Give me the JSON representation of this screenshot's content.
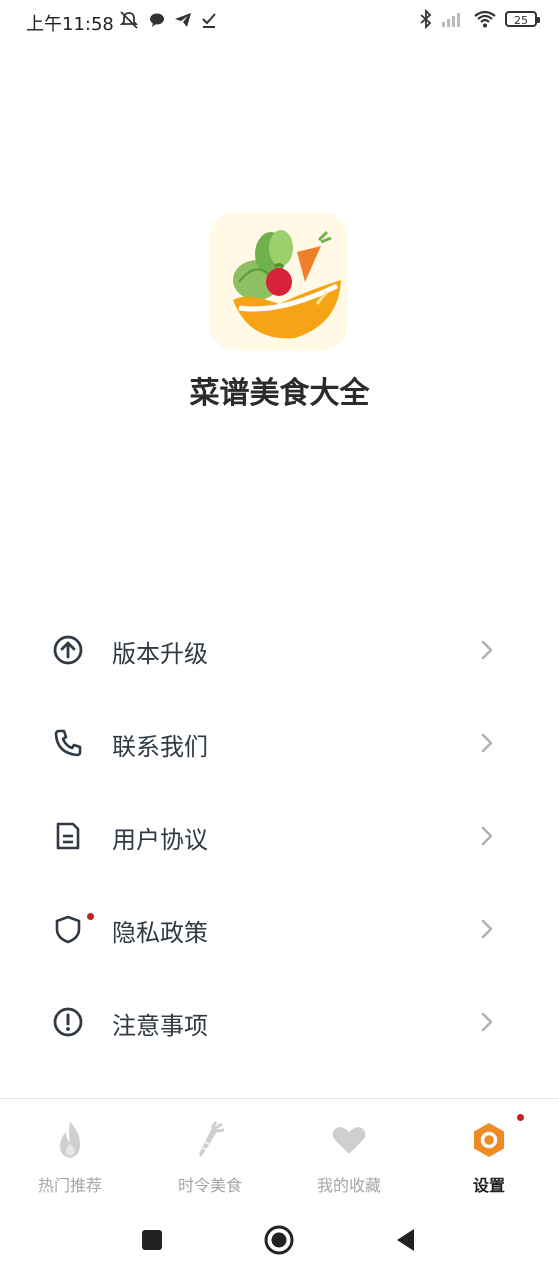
{
  "status_bar": {
    "time": "上午11:58",
    "battery": "25",
    "icons": [
      "mute-notification-icon",
      "chat-bubble-icon",
      "telegram-icon",
      "download-done-icon",
      "bluetooth-icon",
      "signal-icon",
      "wifi-icon",
      "battery-icon"
    ]
  },
  "app": {
    "title": "菜谱美食大全",
    "logo_icon": "vegetable-bowl-logo"
  },
  "menu": {
    "items": [
      {
        "label": "版本升级",
        "icon": "upgrade-arrow-icon"
      },
      {
        "label": "联系我们",
        "icon": "phone-icon"
      },
      {
        "label": "用户协议",
        "icon": "document-icon"
      },
      {
        "label": "隐私政策",
        "icon": "shield-icon",
        "badge": true
      },
      {
        "label": "注意事项",
        "icon": "alert-circle-icon"
      }
    ]
  },
  "tabbar": {
    "tabs": [
      {
        "label": "热门推荐",
        "icon": "flame-icon",
        "active": false
      },
      {
        "label": "时令美食",
        "icon": "carrot-icon",
        "active": false
      },
      {
        "label": "我的收藏",
        "icon": "heart-icon",
        "active": false
      },
      {
        "label": "设置",
        "icon": "settings-hex-icon",
        "active": true,
        "badge": true
      }
    ]
  },
  "colors": {
    "accent": "#f08a24",
    "badge": "#c81e1e",
    "inactive": "#a6a6a6",
    "text": "#2f3a45"
  }
}
